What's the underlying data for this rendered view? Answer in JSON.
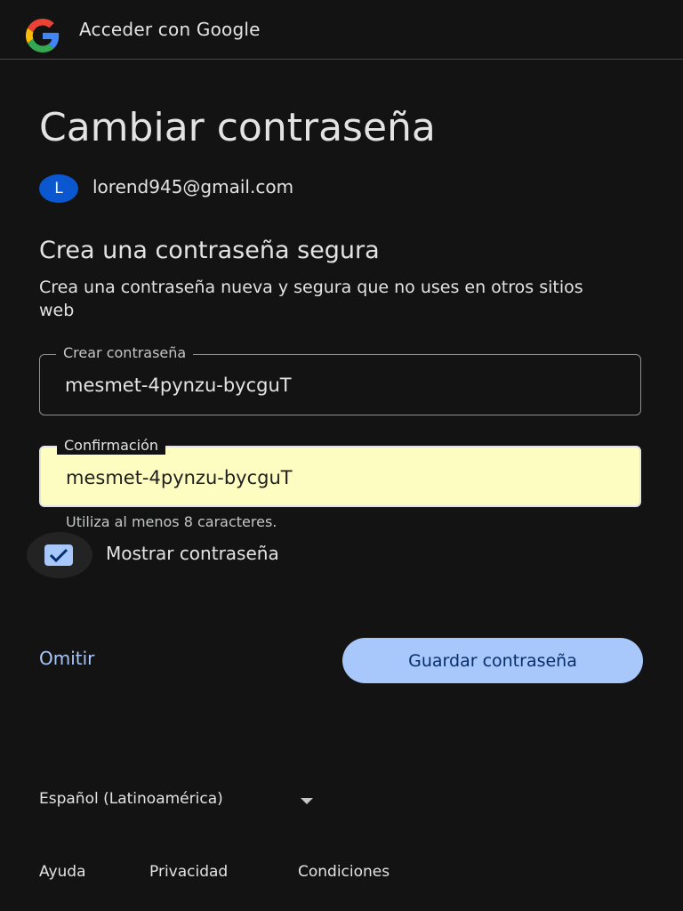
{
  "header": {
    "title": "Acceder con Google",
    "logo_icon": "google-g-icon"
  },
  "main": {
    "headline": "Cambiar contraseña",
    "account": {
      "initial": "L",
      "email": "lorend945@gmail.com"
    },
    "subtitle": "Crea una contraseña segura",
    "description": "Crea una contraseña nueva y segura que no uses en otros sitios web",
    "fields": [
      {
        "label": "Crear contraseña",
        "value": "mesmet-4pynzu-bycguT"
      },
      {
        "label": "Confirmación",
        "value": "mesmet-4pynzu-bycguT"
      }
    ],
    "hint": "Utiliza al menos 8 caracteres.",
    "show_password": {
      "label": "Mostrar contraseña",
      "checked": true
    }
  },
  "actions": {
    "skip_label": "Omitir",
    "save_label": "Guardar contraseña"
  },
  "footer": {
    "language": "Español (Latinoamérica)",
    "links": [
      "Ayuda",
      "Privacidad",
      "Condiciones"
    ]
  },
  "colors": {
    "background": "#131314",
    "accent": "#a8c7fa",
    "autofill": "#fdfdc2",
    "avatar": "#0b57d0"
  }
}
